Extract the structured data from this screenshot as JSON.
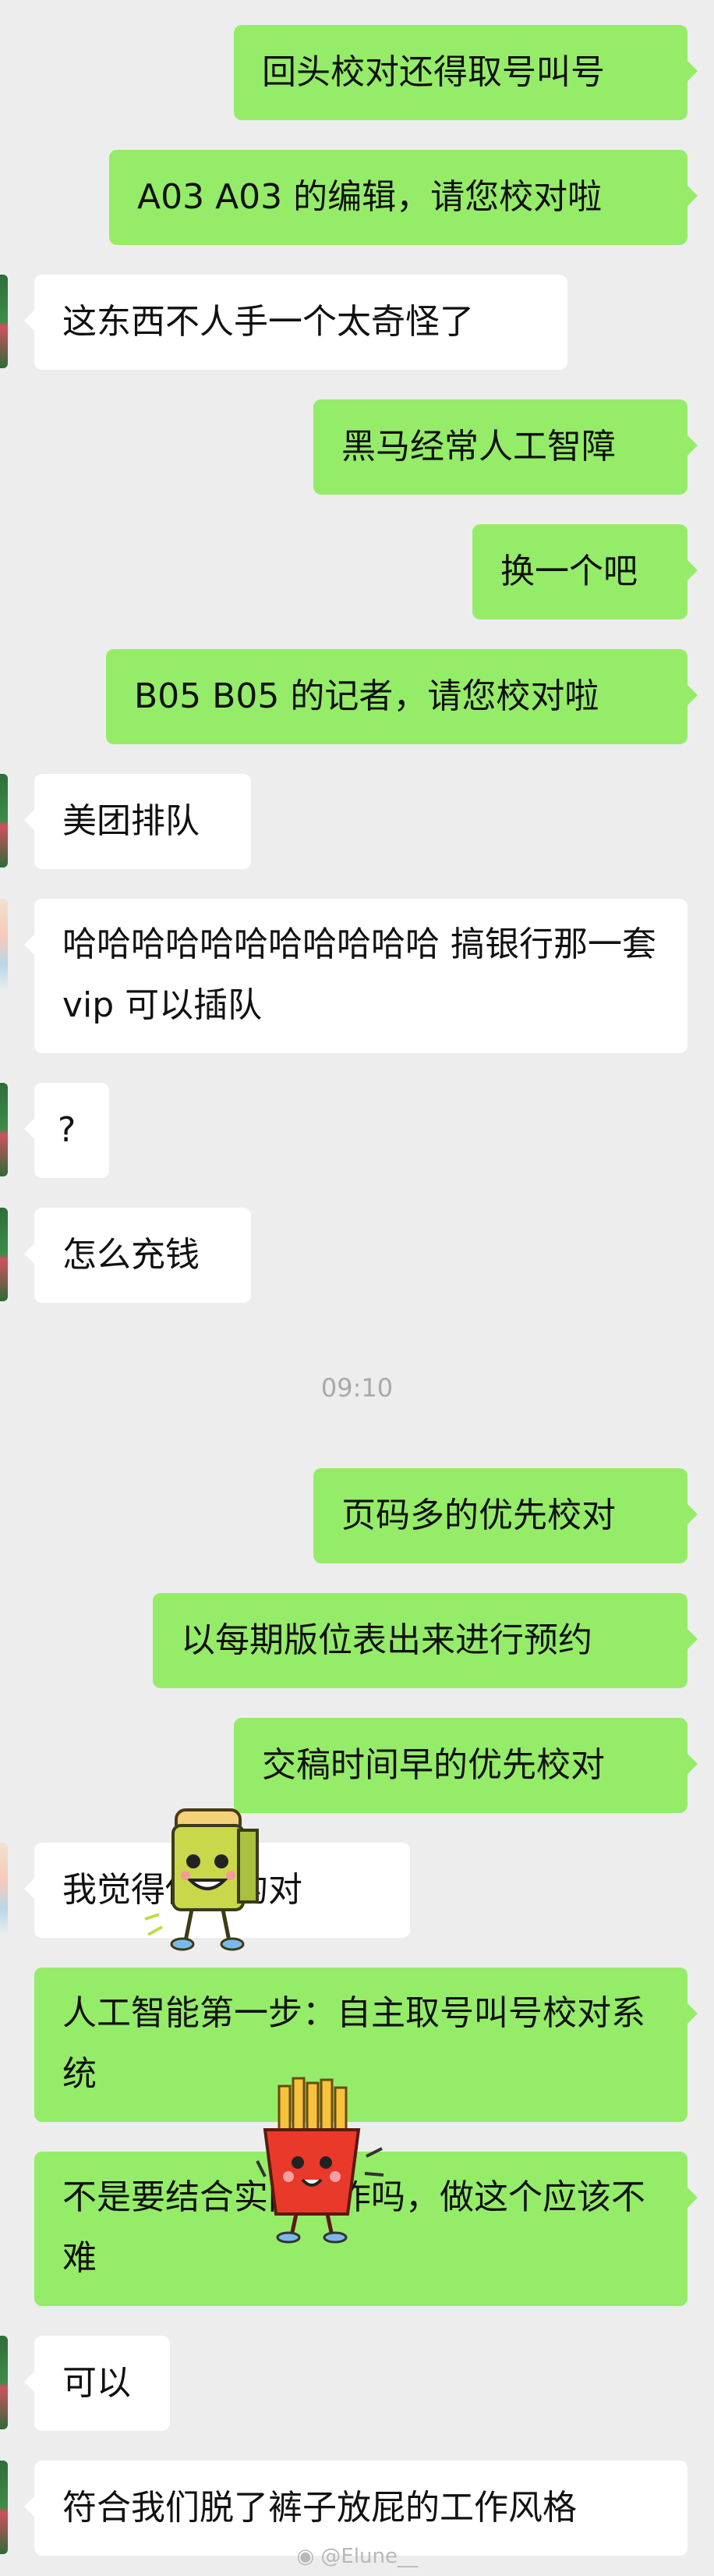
{
  "colors": {
    "background": "#ededed",
    "mine_bubble": "#95ec69",
    "their_bubble": "#ffffff",
    "timestamp": "#a9a9a9"
  },
  "messages": [
    {
      "side": "me",
      "text": "回头校对还得取号叫号"
    },
    {
      "side": "me",
      "text": "A03 A03 的编辑，请您校对啦"
    },
    {
      "side": "them",
      "text": "这东西不人手一个太奇怪了"
    },
    {
      "side": "me",
      "text": "黑马经常人工智障"
    },
    {
      "side": "me",
      "text": "换一个吧"
    },
    {
      "side": "me",
      "text": "B05 B05 的记者，请您校对啦"
    },
    {
      "side": "them",
      "text": "美团排队"
    },
    {
      "side": "them",
      "text": "哈哈哈哈哈哈哈哈哈哈哈 搞银行那一套 vip 可以插队"
    },
    {
      "side": "them",
      "text": "?"
    },
    {
      "side": "them",
      "text": "怎么充钱"
    },
    {
      "side": "me",
      "text": "页码多的优先校对"
    },
    {
      "side": "me",
      "text": "以每期版位表出来进行预约"
    },
    {
      "side": "me",
      "text": "交稿时间早的优先校对"
    },
    {
      "side": "them",
      "text": "我觉得你说的对"
    },
    {
      "side": "me",
      "text": "人工智能第一步：自主取号叫号校对系统"
    },
    {
      "side": "me",
      "text": "不是要结合实际工作吗，做这个应该不难"
    },
    {
      "side": "them",
      "text": "可以"
    },
    {
      "side": "them",
      "text": "符合我们脱了裤子放屁的工作风格"
    }
  ],
  "timestamp": "09:10",
  "stickers": [
    "toast-sticker",
    "fries-sticker"
  ],
  "watermark": "@Elune__"
}
